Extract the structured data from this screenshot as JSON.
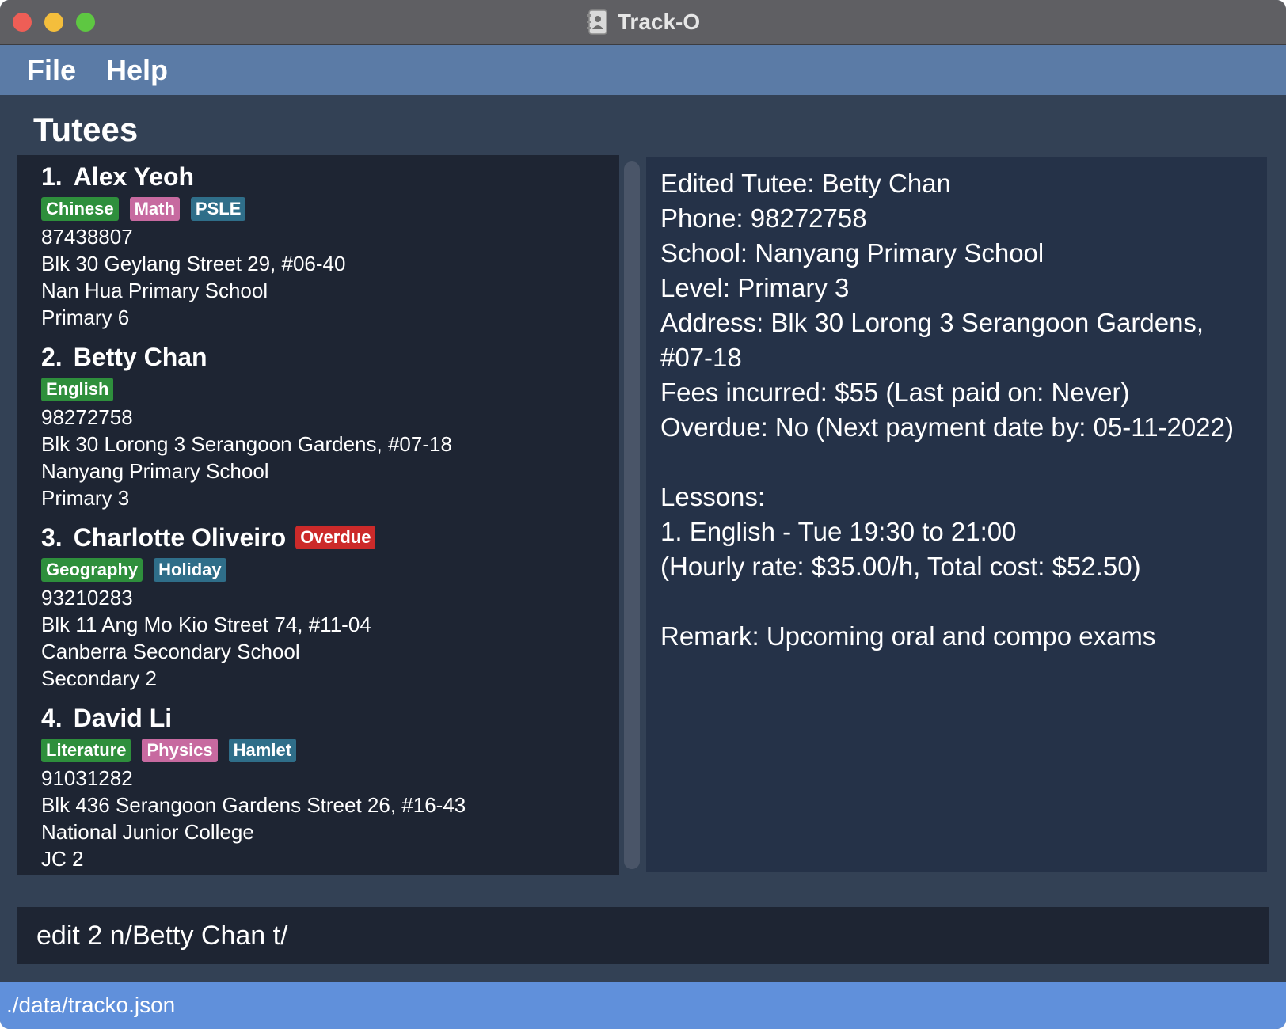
{
  "window": {
    "title": "Track-O"
  },
  "menu": {
    "items": [
      "File",
      "Help"
    ]
  },
  "section_title": "Tutees",
  "tutees": [
    {
      "index": "1.",
      "name": "Alex Yeoh",
      "tags": [
        {
          "label": "Chinese",
          "color": "#2e8f3c"
        },
        {
          "label": "Math",
          "color": "#c76aa0"
        },
        {
          "label": "PSLE",
          "color": "#2f6e89"
        }
      ],
      "phone": "87438807",
      "address": "Blk 30 Geylang Street 29, #06-40",
      "school": "Nan Hua Primary School",
      "level": "Primary 6"
    },
    {
      "index": "2.",
      "name": "Betty Chan",
      "tags": [
        {
          "label": "English",
          "color": "#2e8f3c"
        }
      ],
      "phone": "98272758",
      "address": "Blk 30 Lorong 3 Serangoon Gardens, #07-18",
      "school": "Nanyang Primary School",
      "level": "Primary 3"
    },
    {
      "index": "3.",
      "name": "Charlotte Oliveiro",
      "badge": "Overdue",
      "tags": [
        {
          "label": "Geography",
          "color": "#2e8f3c"
        },
        {
          "label": "Holiday",
          "color": "#2f6e89"
        }
      ],
      "phone": "93210283",
      "address": "Blk 11 Ang Mo Kio Street 74, #11-04",
      "school": "Canberra Secondary School",
      "level": "Secondary 2"
    },
    {
      "index": "4.",
      "name": "David Li",
      "tags": [
        {
          "label": "Literature",
          "color": "#2e8f3c"
        },
        {
          "label": "Physics",
          "color": "#c76aa0"
        },
        {
          "label": "Hamlet",
          "color": "#2f6e89"
        }
      ],
      "phone": "91031282",
      "address": "Blk 436 Serangoon Gardens Street 26, #16-43",
      "school": "National Junior College",
      "level": "JC 2"
    }
  ],
  "detail": {
    "lines": [
      "Edited Tutee: Betty Chan",
      "Phone: 98272758",
      "School: Nanyang Primary School",
      "Level: Primary 3",
      "Address: Blk 30 Lorong 3 Serangoon Gardens,",
      "#07-18",
      "Fees incurred: $55 (Last paid on: Never)",
      "Overdue: No (Next payment date by: 05-11-2022)",
      "",
      "Lessons:",
      "1. English  -  Tue 19:30 to 21:00",
      "(Hourly rate: $35.00/h, Total cost: $52.50)",
      "",
      "Remark: Upcoming oral and compo exams"
    ]
  },
  "command": {
    "value": "edit 2 n/Betty Chan t/"
  },
  "status": {
    "path": "./data/tracko.json"
  }
}
